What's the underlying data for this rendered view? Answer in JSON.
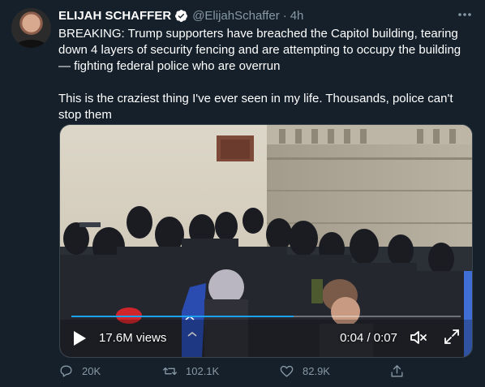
{
  "tweet": {
    "display_name": "ELIJAH SCHAFFER",
    "handle": "@ElijahSchaffer",
    "separator": "·",
    "time": "4h",
    "text": "BREAKING: Trump supporters have breached the Capitol building, tearing down 4 layers of security fencing and are attempting to occupy the building — fighting federal police who are overrun\n\nThis is the craziest thing I've ever seen in my life. Thousands, police can't stop them"
  },
  "video": {
    "views": "17.6M views",
    "timecode": "0:04 / 0:07",
    "progress": 0.57
  },
  "actions": {
    "replies": "20K",
    "retweets": "102.1K",
    "likes": "82.9K"
  },
  "colors": {
    "background": "#15202b",
    "secondary_text": "#8899a6",
    "accent": "#1da1f2"
  },
  "icons": [
    "verified-badge-icon",
    "more-icon",
    "play-icon",
    "volume-icon",
    "expand-icon",
    "reply-icon",
    "retweet-icon",
    "like-icon",
    "share-icon"
  ]
}
